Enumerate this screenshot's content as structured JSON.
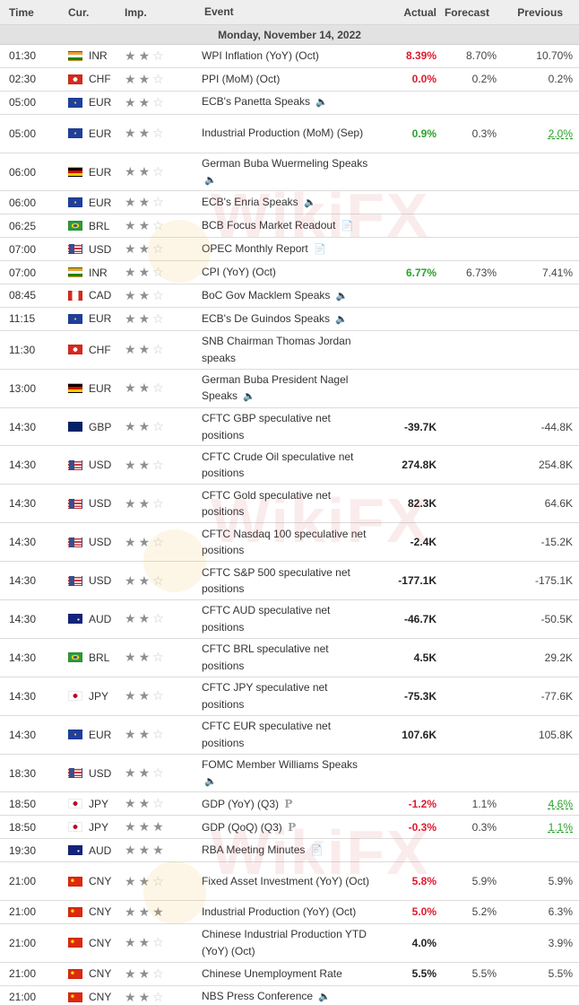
{
  "header": {
    "time": "Time",
    "currency": "Cur.",
    "importance": "Imp.",
    "event": "Event",
    "actual": "Actual",
    "forecast": "Forecast",
    "previous": "Previous"
  },
  "date_label": "Monday, November 14, 2022",
  "watermark": "WikiFX",
  "colors": {
    "negative_surprise": "#e0192e",
    "positive_surprise": "#2aa12a",
    "header_bg": "#eeeeee",
    "date_bg": "#e2e2e2"
  },
  "events": [
    {
      "time": "01:30",
      "flag": "INR",
      "currency": "INR",
      "stars": 2,
      "event": "WPI Inflation (YoY) (Oct)",
      "icon": "",
      "actual": "8.39%",
      "actual_color": "red",
      "forecast": "8.70%",
      "previous": "10.70%",
      "prev_color": "",
      "tall": false
    },
    {
      "time": "02:30",
      "flag": "CHF",
      "currency": "CHF",
      "stars": 2,
      "event": "PPI (MoM) (Oct)",
      "icon": "",
      "actual": "0.0%",
      "actual_color": "red",
      "forecast": "0.2%",
      "previous": "0.2%",
      "prev_color": "",
      "tall": false
    },
    {
      "time": "05:00",
      "flag": "EUR",
      "currency": "EUR",
      "stars": 2,
      "event": "ECB's Panetta Speaks",
      "icon": "speaker",
      "actual": "",
      "actual_color": "",
      "forecast": "",
      "previous": "",
      "prev_color": "",
      "tall": false
    },
    {
      "time": "05:00",
      "flag": "EUR",
      "currency": "EUR",
      "stars": 2,
      "event": "Industrial Production (MoM) (Sep)",
      "icon": "",
      "actual": "0.9%",
      "actual_color": "green",
      "forecast": "0.3%",
      "previous": "2.0%",
      "prev_color": "green",
      "tall": true
    },
    {
      "time": "06:00",
      "flag": "DEU",
      "currency": "EUR",
      "stars": 2,
      "event": "German Buba Wuermeling Speaks",
      "icon": "speaker",
      "actual": "",
      "actual_color": "",
      "forecast": "",
      "previous": "",
      "prev_color": "",
      "tall": true
    },
    {
      "time": "06:00",
      "flag": "EUR",
      "currency": "EUR",
      "stars": 2,
      "event": "ECB's Enria Speaks",
      "icon": "speaker",
      "actual": "",
      "actual_color": "",
      "forecast": "",
      "previous": "",
      "prev_color": "",
      "tall": false
    },
    {
      "time": "06:25",
      "flag": "BRL",
      "currency": "BRL",
      "stars": 2,
      "event": "BCB Focus Market Readout",
      "icon": "report",
      "actual": "",
      "actual_color": "",
      "forecast": "",
      "previous": "",
      "prev_color": "",
      "tall": false
    },
    {
      "time": "07:00",
      "flag": "USD",
      "currency": "USD",
      "stars": 2,
      "event": "OPEC Monthly Report",
      "icon": "report",
      "actual": "",
      "actual_color": "",
      "forecast": "",
      "previous": "",
      "prev_color": "",
      "tall": false
    },
    {
      "time": "07:00",
      "flag": "INR",
      "currency": "INR",
      "stars": 2,
      "event": "CPI (YoY) (Oct)",
      "icon": "",
      "actual": "6.77%",
      "actual_color": "green",
      "forecast": "6.73%",
      "previous": "7.41%",
      "prev_color": "",
      "tall": false
    },
    {
      "time": "08:45",
      "flag": "CAD",
      "currency": "CAD",
      "stars": 2,
      "event": "BoC Gov Macklem Speaks",
      "icon": "speaker",
      "actual": "",
      "actual_color": "",
      "forecast": "",
      "previous": "",
      "prev_color": "",
      "tall": false
    },
    {
      "time": "11:15",
      "flag": "EUR",
      "currency": "EUR",
      "stars": 2,
      "event": "ECB's De Guindos Speaks",
      "icon": "speaker",
      "actual": "",
      "actual_color": "",
      "forecast": "",
      "previous": "",
      "prev_color": "",
      "tall": false
    },
    {
      "time": "11:30",
      "flag": "CHF",
      "currency": "CHF",
      "stars": 2,
      "event": "SNB Chairman Thomas Jordan speaks",
      "icon": "",
      "actual": "",
      "actual_color": "",
      "forecast": "",
      "previous": "",
      "prev_color": "",
      "tall": true
    },
    {
      "time": "13:00",
      "flag": "DEU",
      "currency": "EUR",
      "stars": 2,
      "event": "German Buba President Nagel Speaks",
      "icon": "speaker",
      "actual": "",
      "actual_color": "",
      "forecast": "",
      "previous": "",
      "prev_color": "",
      "tall": true
    },
    {
      "time": "14:30",
      "flag": "GBP",
      "currency": "GBP",
      "stars": 2,
      "event": "CFTC GBP speculative net positions",
      "icon": "",
      "actual": "-39.7K",
      "actual_color": "black",
      "forecast": "",
      "previous": "-44.8K",
      "prev_color": "",
      "tall": true
    },
    {
      "time": "14:30",
      "flag": "USD",
      "currency": "USD",
      "stars": 2,
      "event": "CFTC Crude Oil speculative net positions",
      "icon": "",
      "actual": "274.8K",
      "actual_color": "black",
      "forecast": "",
      "previous": "254.8K",
      "prev_color": "",
      "tall": true
    },
    {
      "time": "14:30",
      "flag": "USD",
      "currency": "USD",
      "stars": 2,
      "event": "CFTC Gold speculative net positions",
      "icon": "",
      "actual": "82.3K",
      "actual_color": "black",
      "forecast": "",
      "previous": "64.6K",
      "prev_color": "",
      "tall": true
    },
    {
      "time": "14:30",
      "flag": "USD",
      "currency": "USD",
      "stars": 2,
      "event": "CFTC Nasdaq 100 speculative net positions",
      "icon": "",
      "actual": "-2.4K",
      "actual_color": "black",
      "forecast": "",
      "previous": "-15.2K",
      "prev_color": "",
      "tall": true
    },
    {
      "time": "14:30",
      "flag": "USD",
      "currency": "USD",
      "stars": 2,
      "event": "CFTC S&P 500 speculative net positions",
      "icon": "",
      "actual": "-177.1K",
      "actual_color": "black",
      "forecast": "",
      "previous": "-175.1K",
      "prev_color": "",
      "tall": true
    },
    {
      "time": "14:30",
      "flag": "AUD",
      "currency": "AUD",
      "stars": 2,
      "event": "CFTC AUD speculative net positions",
      "icon": "",
      "actual": "-46.7K",
      "actual_color": "black",
      "forecast": "",
      "previous": "-50.5K",
      "prev_color": "",
      "tall": true
    },
    {
      "time": "14:30",
      "flag": "BRL",
      "currency": "BRL",
      "stars": 2,
      "event": "CFTC BRL speculative net positions",
      "icon": "",
      "actual": "4.5K",
      "actual_color": "black",
      "forecast": "",
      "previous": "29.2K",
      "prev_color": "",
      "tall": true
    },
    {
      "time": "14:30",
      "flag": "JPY",
      "currency": "JPY",
      "stars": 2,
      "event": "CFTC JPY speculative net positions",
      "icon": "",
      "actual": "-75.3K",
      "actual_color": "black",
      "forecast": "",
      "previous": "-77.6K",
      "prev_color": "",
      "tall": true
    },
    {
      "time": "14:30",
      "flag": "EUR",
      "currency": "EUR",
      "stars": 2,
      "event": "CFTC EUR speculative net positions",
      "icon": "",
      "actual": "107.6K",
      "actual_color": "black",
      "forecast": "",
      "previous": "105.8K",
      "prev_color": "",
      "tall": true
    },
    {
      "time": "18:30",
      "flag": "USD",
      "currency": "USD",
      "stars": 2,
      "event": "FOMC Member Williams Speaks",
      "icon": "speaker",
      "actual": "",
      "actual_color": "",
      "forecast": "",
      "previous": "",
      "prev_color": "",
      "tall": true
    },
    {
      "time": "18:50",
      "flag": "JPY",
      "currency": "JPY",
      "stars": 2,
      "event": "GDP (YoY) (Q3)",
      "icon": "preliminary",
      "actual": "-1.2%",
      "actual_color": "red",
      "forecast": "1.1%",
      "previous": "4.6%",
      "prev_color": "green",
      "tall": false
    },
    {
      "time": "18:50",
      "flag": "JPY",
      "currency": "JPY",
      "stars": 3,
      "event": "GDP (QoQ) (Q3)",
      "icon": "preliminary",
      "actual": "-0.3%",
      "actual_color": "red",
      "forecast": "0.3%",
      "previous": "1.1%",
      "prev_color": "green",
      "tall": false
    },
    {
      "time": "19:30",
      "flag": "AUD",
      "currency": "AUD",
      "stars": 3,
      "event": "RBA Meeting Minutes",
      "icon": "report",
      "actual": "",
      "actual_color": "",
      "forecast": "",
      "previous": "",
      "prev_color": "",
      "tall": false
    },
    {
      "time": "21:00",
      "flag": "CNY",
      "currency": "CNY",
      "stars": 2,
      "event": "Fixed Asset Investment (YoY) (Oct)",
      "icon": "",
      "actual": "5.8%",
      "actual_color": "red",
      "forecast": "5.9%",
      "previous": "5.9%",
      "prev_color": "",
      "tall": true
    },
    {
      "time": "21:00",
      "flag": "CNY",
      "currency": "CNY",
      "stars": 3,
      "event": "Industrial Production (YoY) (Oct)",
      "icon": "",
      "actual": "5.0%",
      "actual_color": "red",
      "forecast": "5.2%",
      "previous": "6.3%",
      "prev_color": "",
      "tall": false
    },
    {
      "time": "21:00",
      "flag": "CNY",
      "currency": "CNY",
      "stars": 2,
      "event": "Chinese Industrial Production YTD (YoY) (Oct)",
      "icon": "",
      "actual": "4.0%",
      "actual_color": "black",
      "forecast": "",
      "previous": "3.9%",
      "prev_color": "",
      "tall": true
    },
    {
      "time": "21:00",
      "flag": "CNY",
      "currency": "CNY",
      "stars": 2,
      "event": "Chinese Unemployment Rate",
      "icon": "",
      "actual": "5.5%",
      "actual_color": "black",
      "forecast": "5.5%",
      "previous": "5.5%",
      "prev_color": "",
      "tall": false
    },
    {
      "time": "21:00",
      "flag": "CNY",
      "currency": "CNY",
      "stars": 2,
      "event": "NBS Press Conference",
      "icon": "speaker",
      "actual": "",
      "actual_color": "",
      "forecast": "",
      "previous": "",
      "prev_color": "",
      "tall": false
    }
  ]
}
